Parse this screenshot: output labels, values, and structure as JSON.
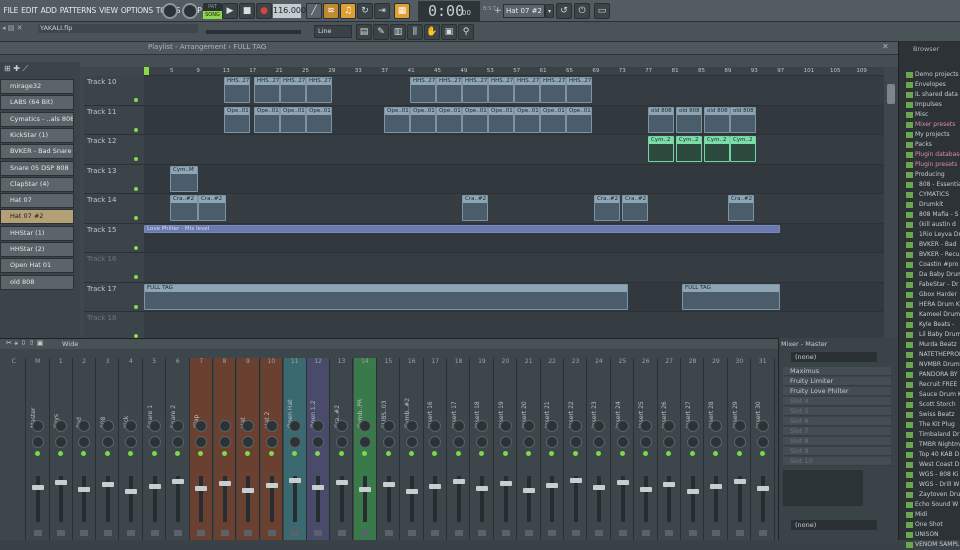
{
  "menu": [
    "FILE",
    "EDIT",
    "ADD",
    "PATTERNS",
    "VIEW",
    "OPTIONS",
    "TOOLS",
    "HELP"
  ],
  "transport": {
    "pat": "PAT",
    "song": "SONG",
    "tempo": "116.000",
    "time": "0:00",
    "time_small": "00",
    "bst": "B:S:T",
    "pattern": "Hat 07 #2"
  },
  "hint": {
    "file": "YAKALI.flp"
  },
  "snap": "Line",
  "playlist": {
    "title": "Playlist - Arrangement › FULL TAG",
    "ruler": [
      "5",
      "9",
      "13",
      "17",
      "21",
      "25",
      "29",
      "33",
      "37",
      "41",
      "45",
      "49",
      "53",
      "57",
      "61",
      "65",
      "69",
      "73",
      "77",
      "81",
      "85",
      "89",
      "93",
      "97",
      "101",
      "105",
      "109"
    ],
    "tracks": [
      "Track 10",
      "Track 11",
      "Track 12",
      "Track 13",
      "Track 14",
      "Track 15",
      "Track 16",
      "Track 17",
      "Track 18"
    ]
  },
  "clips": {
    "hhs": "HHS..27",
    "ope": "Ope..01",
    "cym": "Cym..2",
    "cymM": "Cym..M",
    "cra": "Cra..#2",
    "old": "old 808",
    "love": "Love Philter - Mix level",
    "full": "FULL TAG"
  },
  "channels": [
    "mirage32",
    "LABS (64 Bit)",
    "Cymatics - ..als 808 1 - C",
    "KickStar (1)",
    "BVKER - Bad Snare 07",
    "Snare 05 DSP 808",
    "ClapStar (4)",
    "Hat 07",
    "Hat 07 #2",
    "HHStar (1)",
    "HHStar (2)",
    "Open Hat 01",
    "old 808"
  ],
  "mixer": {
    "view": "Wide",
    "numbers": [
      "C",
      "M",
      "1",
      "2",
      "3",
      "4",
      "5",
      "6",
      "7",
      "8",
      "9",
      "10",
      "11",
      "12",
      "13",
      "14",
      "15",
      "16",
      "17",
      "18",
      "19",
      "20",
      "21",
      "22",
      "23",
      "24",
      "25",
      "26",
      "27",
      "28",
      "29",
      "30",
      "31"
    ],
    "names": [
      "",
      "Master",
      "Keys",
      "Pad",
      "808",
      "Kick",
      "Snare 1",
      "Snare 2",
      "Clap",
      "",
      "Hat",
      "Hat 2",
      "Open Hat",
      "Open 1.2",
      "Cra..#2",
      "Cymb..PR",
      "SUBS..03",
      "Cymb..#2",
      "Insert 16",
      "Insert 17",
      "Insert 18",
      "Insert 19",
      "Insert 20",
      "Insert 21",
      "Insert 22",
      "Insert 23",
      "Insert 24",
      "Insert 25",
      "Insert 26",
      "Insert 27",
      "Insert 28",
      "Insert 29",
      "Insert 30"
    ]
  },
  "master": {
    "title": "Mixer - Master",
    "input": "(none)",
    "output": "(none)",
    "slots": [
      "Maximus",
      "Fruity Limiter",
      "Fruity Love Philter",
      "Slot 4",
      "Slot 5",
      "Slot 6",
      "Slot 7",
      "Slot 8",
      "Slot 9",
      "Slot 10"
    ]
  },
  "browser": {
    "title": "Browser",
    "items": [
      "Demo projects",
      "Envelopes",
      "IL shared data",
      "Impulses",
      "Misc",
      "Mixer presets",
      "My projects",
      "Packs",
      "Plugin database",
      "Plugin presets",
      "Producing",
      "808 - Essentia",
      "CYMATICS",
      "Drumkit",
      "808 Mafia - S",
      "(kill austin d",
      "1Rio Leyva Dr",
      "BVKER - Bad",
      "BVKER - Recu",
      "Coastin #pro",
      "Da Baby Drum",
      "FabeStar - Dr",
      "Gbox Harder",
      "HERA Drum Ki",
      "Kameel Drum",
      "Kyle Beats -",
      "Lil Baby Drum",
      "Murda Beatz",
      "NATETHEPROD",
      "NVMBR Drumk",
      "PANDORA BY",
      "Recruit FREE",
      "Sauce Drum K",
      "Scott Storch",
      "Swiss Beatz",
      "The Kit Plug",
      "Timbaland Dr",
      "TMBR Nightm",
      "Top 40 KAB D",
      "West Coast D",
      "WGS - 808 Ki",
      "WGS - Drill W",
      "Zaytoven Dru",
      "Echo Sound W",
      "Midi",
      "One Shot",
      "UNISON",
      "VENOM SAMPL"
    ]
  }
}
